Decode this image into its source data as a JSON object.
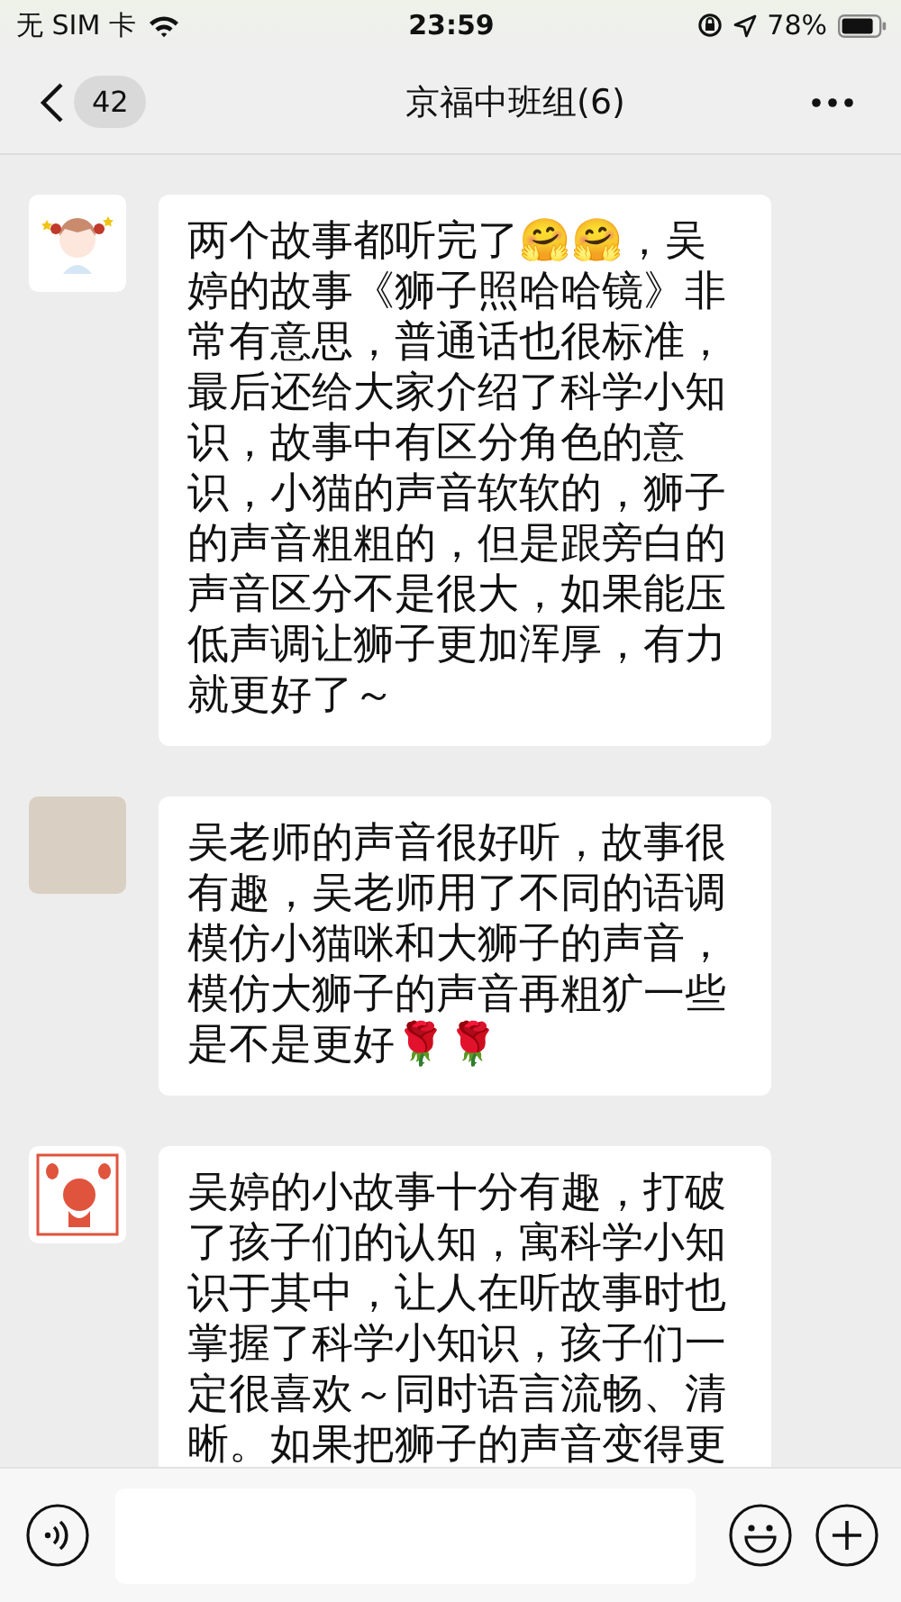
{
  "status_bar": {
    "carrier": "无 SIM 卡",
    "time": "23:59",
    "battery": "78%"
  },
  "nav": {
    "back_count": "42",
    "title": "京福中班组(6)"
  },
  "messages": [
    {
      "avatar": {
        "kind": "cartoon"
      },
      "text": "两个故事都听完了🤗🤗，吴婷的故事《狮子照哈哈镜》非常有意思，普通话也很标准，最后还给大家介绍了科学小知识，故事中有区分角色的意识，小猫的声音软软的，狮子的声音粗粗的，但是跟旁白的声音区分不是很大，如果能压低声调让狮子更加浑厚，有力就更好了～"
    },
    {
      "avatar": {
        "kind": "photo"
      },
      "text": "吴老师的声音很好听，故事很有趣，吴老师用了不同的语调模仿小猫咪和大狮子的声音，模仿大狮子的声音再粗犷一些是不是更好🌹🌹"
    },
    {
      "avatar": {
        "kind": "stamp"
      },
      "text": "吴婷的小故事十分有趣，打破了孩子们的认知，寓科学小知识于其中，让人在听故事时也掌握了科学小知识，孩子们一定很喜欢～同时语言流畅、清晰。如果把狮子的声音变得更"
    }
  ]
}
